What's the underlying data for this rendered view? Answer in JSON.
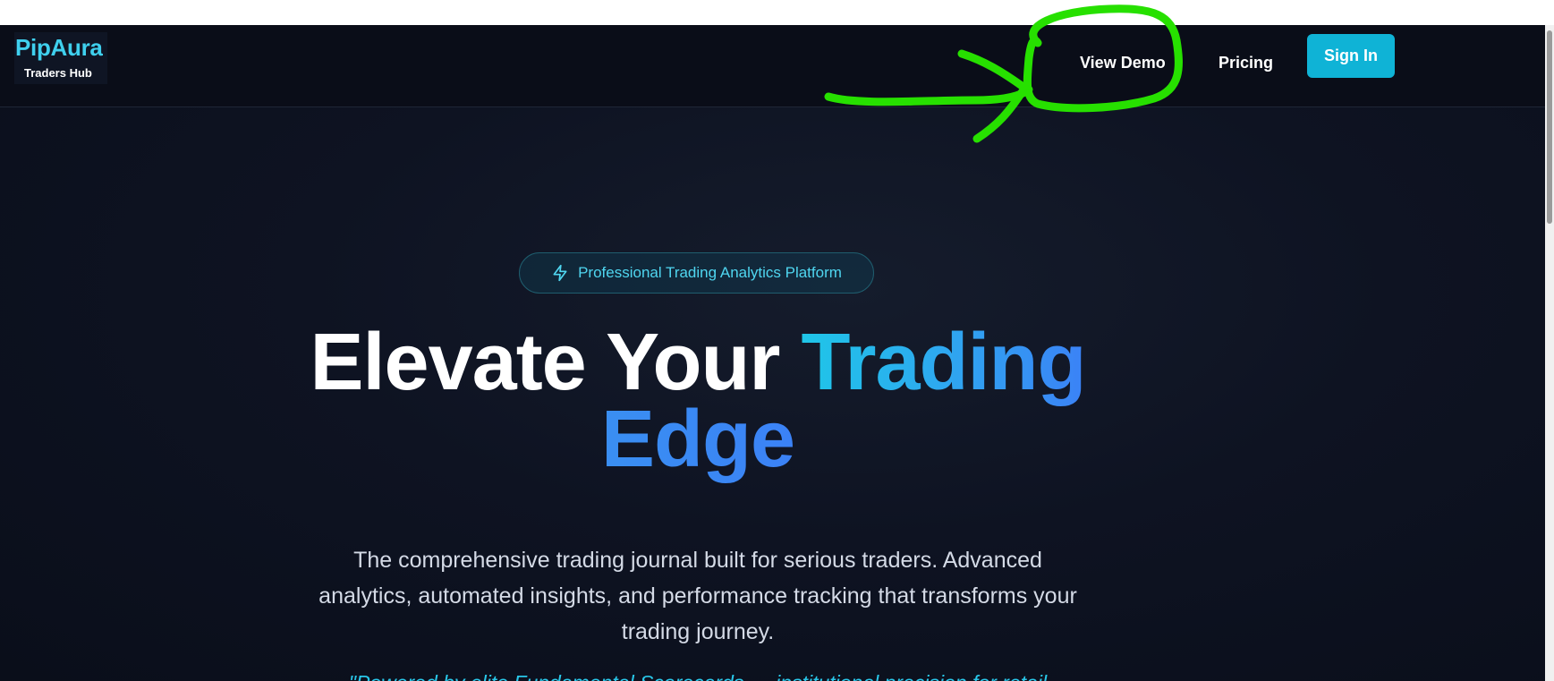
{
  "brand": {
    "name": "PipAura",
    "tagline": "Traders Hub"
  },
  "nav": {
    "view_demo": "View Demo",
    "pricing": "Pricing",
    "sign_in": "Sign In"
  },
  "hero": {
    "badge_icon": "lightning-bolt-icon",
    "badge_text": "Professional Trading Analytics Platform",
    "title_white": "Elevate Your ",
    "title_accent_1": "Trading",
    "title_accent_2": "Edge",
    "description": "The comprehensive trading journal built for serious traders. Advanced analytics, automated insights, and performance tracking that transforms your trading journey.",
    "quote": "\"Powered by elite Fundamental Scorecards — institutional precision for retail"
  },
  "colors": {
    "accent_cyan": "#0fb3d6",
    "accent_blue": "#3b82f6",
    "background": "#0a0e1a",
    "annotation_green": "#27e000"
  }
}
